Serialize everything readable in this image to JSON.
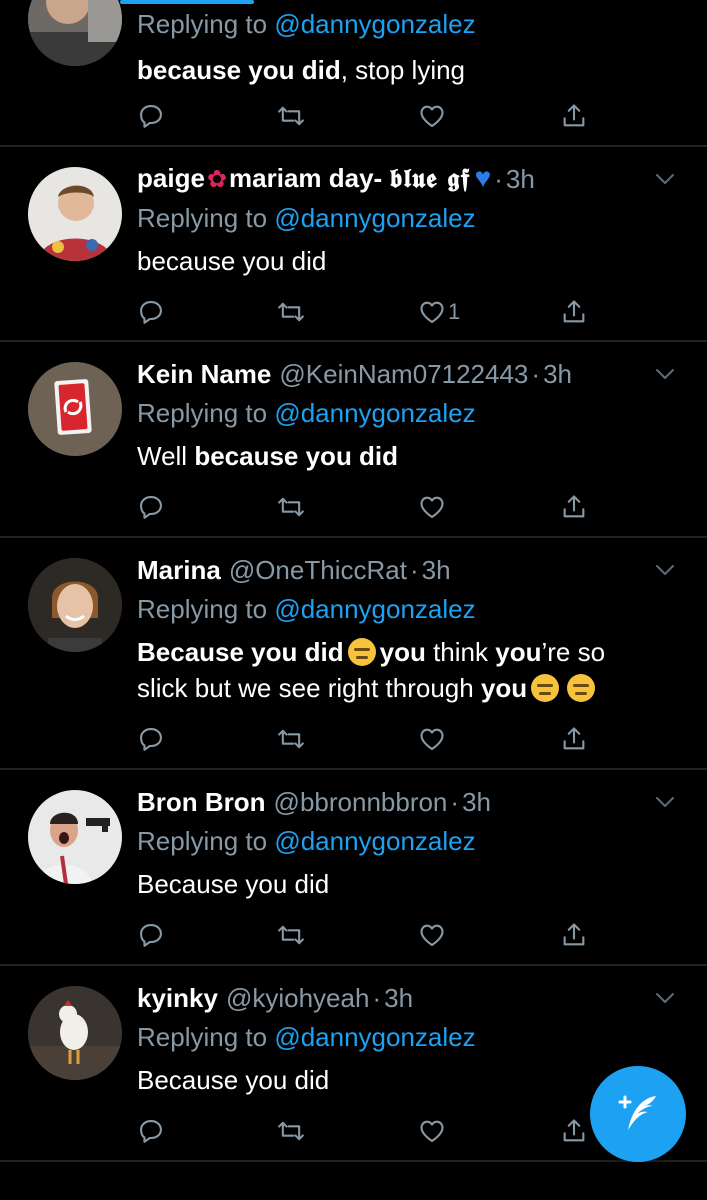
{
  "colors": {
    "background": "#000000",
    "accent": "#1da1f2",
    "secondary_text": "#8899a6",
    "divider": "#1f2326"
  },
  "reply_prefix": "Replying to",
  "tweets": [
    {
      "display_name": "",
      "handle": "",
      "time": "",
      "replying_to": "@dannygonzalez",
      "text_parts": [
        {
          "t": "because you did",
          "b": true
        },
        {
          "t": ", stop lying",
          "b": false
        }
      ],
      "likes": ""
    },
    {
      "display_name_a": "paige",
      "display_name_b": "mariam day- ",
      "display_name_c": "𝖇𝖑𝖚𝖊 𝖌𝖋",
      "handle": "",
      "time": "3h",
      "replying_to": "@dannygonzalez",
      "text": "because you did",
      "likes": "1"
    },
    {
      "display_name": "Kein Name",
      "handle": "@KeinNam07122443",
      "time": "3h",
      "replying_to": "@dannygonzalez",
      "text_plain": "Well ",
      "text_bold": "because you did",
      "likes": ""
    },
    {
      "display_name": "Marina",
      "handle": "@OneThiccRat",
      "time": "3h",
      "replying_to": "@dannygonzalez",
      "line1_bold1": "Because you did",
      "line1_bold2": "you",
      "line1_plain1": " think ",
      "line1_bold3": "you",
      "line1_plain2": "’re so",
      "line2_plain": "slick but we see right through ",
      "line2_bold": "you",
      "likes": ""
    },
    {
      "display_name": "Bron Bron",
      "handle": "@bbronnbbron",
      "time": "3h",
      "replying_to": "@dannygonzalez",
      "text": "Because you did",
      "likes": ""
    },
    {
      "display_name": "kyinky",
      "handle": "@kyiohyeah",
      "time": "3h",
      "replying_to": "@dannygonzalez",
      "text": "Because you did",
      "likes": ""
    }
  ],
  "icons": {
    "reply": "reply-icon",
    "retweet": "retweet-icon",
    "like": "heart-icon",
    "share": "share-icon",
    "chevron": "chevron-down-icon",
    "compose": "compose-tweet-icon"
  }
}
